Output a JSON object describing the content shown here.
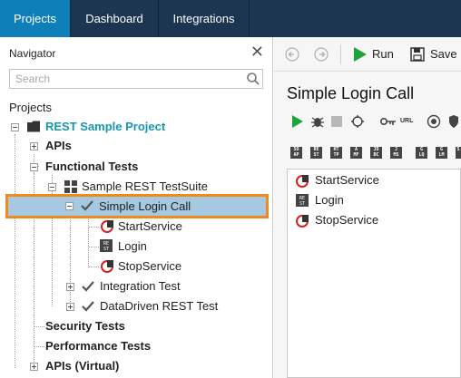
{
  "topbar": {
    "tabs": [
      {
        "label": "Projects",
        "active": true
      },
      {
        "label": "Dashboard",
        "active": false
      },
      {
        "label": "Integrations",
        "active": false
      }
    ]
  },
  "navigator": {
    "title": "Navigator",
    "search_placeholder": "Search",
    "section_label": "Projects",
    "tree": {
      "project": "REST Sample Project",
      "apis": "APIs",
      "functional_tests": "Functional Tests",
      "suite": "Sample REST TestSuite",
      "test_case": "Simple Login Call",
      "steps": [
        "StartService",
        "Login",
        "StopService"
      ],
      "integration_test": "Integration Test",
      "datadriven_test": "DataDriven REST Test",
      "security_tests": "Security Tests",
      "performance_tests": "Performance Tests",
      "apis_virtual": "APIs (Virtual)"
    }
  },
  "editor": {
    "run_label": "Run",
    "save_label": "Save",
    "title": "Simple Login Call",
    "url_label": "URL",
    "steps": [
      "StartService",
      "Login",
      "StopService"
    ]
  },
  "colors": {
    "topbar_bg": "#1c3550",
    "active_tab": "#0e7fb8",
    "selection_border": "#f08a1f",
    "selection_fill": "#a6c8e0",
    "project_text": "#1a96b0",
    "run_green": "#1ea33b"
  }
}
